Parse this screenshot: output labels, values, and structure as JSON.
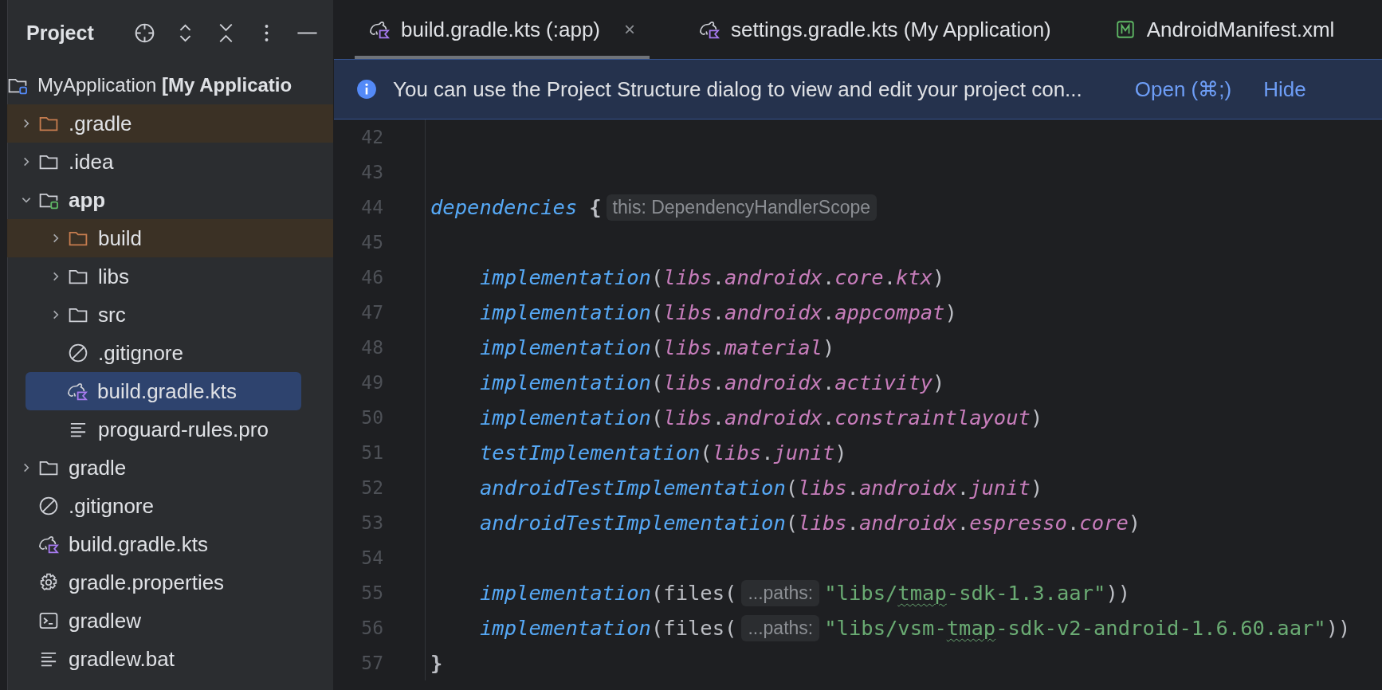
{
  "sidebar": {
    "title": "Project",
    "root": {
      "label": "MyApplication **[My Applicatio**",
      "kind": "project",
      "selected": false
    },
    "tree": [
      {
        "label": ".gradle",
        "kind": "folder",
        "expanded": false,
        "excluded": true,
        "bold": false,
        "selected": false
      },
      {
        "label": ".idea",
        "kind": "folder",
        "expanded": false,
        "excluded": false,
        "bold": false,
        "selected": false
      },
      {
        "label": "app",
        "kind": "module",
        "expanded": true,
        "excluded": false,
        "bold": true,
        "selected": false,
        "children": [
          {
            "label": "build",
            "kind": "folder",
            "expanded": false,
            "excluded": true,
            "bold": false,
            "selected": false
          },
          {
            "label": "libs",
            "kind": "folder",
            "expanded": false,
            "excluded": false,
            "bold": false,
            "selected": false
          },
          {
            "label": "src",
            "kind": "folder",
            "expanded": false,
            "excluded": false,
            "bold": false,
            "selected": false
          },
          {
            "label": ".gitignore",
            "kind": "ignore",
            "excluded": false,
            "bold": false,
            "selected": false
          },
          {
            "label": "build.gradle.kts",
            "kind": "gradle",
            "excluded": false,
            "bold": false,
            "selected": true
          },
          {
            "label": "proguard-rules.pro",
            "kind": "text",
            "excluded": false,
            "bold": false,
            "selected": false
          }
        ]
      },
      {
        "label": "gradle",
        "kind": "folder",
        "expanded": false,
        "excluded": false,
        "bold": false,
        "selected": false
      },
      {
        "label": ".gitignore",
        "kind": "ignore",
        "excluded": false,
        "bold": false,
        "selected": false
      },
      {
        "label": "build.gradle.kts",
        "kind": "gradle",
        "excluded": false,
        "bold": false,
        "selected": false
      },
      {
        "label": "gradle.properties",
        "kind": "gear",
        "excluded": false,
        "bold": false,
        "selected": false
      },
      {
        "label": "gradlew",
        "kind": "terminal",
        "excluded": false,
        "bold": false,
        "selected": false
      },
      {
        "label": "gradlew.bat",
        "kind": "text",
        "excluded": false,
        "bold": false,
        "selected": false
      }
    ]
  },
  "tabs": [
    {
      "label": "build.gradle.kts (:app)",
      "kind": "gradle",
      "selected": true,
      "close": "×"
    },
    {
      "label": "settings.gradle.kts (My Application)",
      "kind": "gradle",
      "selected": false
    },
    {
      "label": "AndroidManifest.xml",
      "kind": "manifest",
      "selected": false
    }
  ],
  "banner": {
    "text": "You can use the Project Structure dialog to view and edit your project con...",
    "links": [
      "Open (⌘;)",
      "Hide"
    ]
  },
  "editor": {
    "lines": [
      {
        "number": "42",
        "kind": "top"
      },
      {
        "number": "43",
        "kind": "top"
      },
      {
        "number": "44",
        "kind": "top",
        "segments": [
          {
            "kind": "code",
            "tokens": [
              {
                "kind": "keyword",
                "text": "dependencies"
              },
              {
                "kind": "brace",
                "text": "{"
              }
            ]
          },
          {
            "kind": "hint",
            "text": "this: DependencyHandlerScope"
          }
        ]
      },
      {
        "number": "45",
        "kind": "top"
      },
      {
        "number": "46",
        "kind": "nested",
        "segments": [
          {
            "kind": "code",
            "tokens": [
              {
                "kind": "keyword",
                "text": "implementation"
              },
              {
                "kind": "punct",
                "text": "("
              },
              {
                "kind": "member",
                "text": "libs"
              },
              {
                "kind": "punct",
                "text": "."
              },
              {
                "kind": "member",
                "text": "androidx"
              },
              {
                "kind": "punct",
                "text": "."
              },
              {
                "kind": "member",
                "text": "core"
              },
              {
                "kind": "punct",
                "text": "."
              },
              {
                "kind": "member",
                "text": "ktx"
              },
              {
                "kind": "punct",
                "text": ")"
              }
            ]
          }
        ]
      },
      {
        "number": "47",
        "kind": "nested",
        "segments": [
          {
            "kind": "code",
            "tokens": [
              {
                "kind": "keyword",
                "text": "implementation"
              },
              {
                "kind": "punct",
                "text": "("
              },
              {
                "kind": "member",
                "text": "libs"
              },
              {
                "kind": "punct",
                "text": "."
              },
              {
                "kind": "member",
                "text": "androidx"
              },
              {
                "kind": "punct",
                "text": "."
              },
              {
                "kind": "member",
                "text": "appcompat"
              },
              {
                "kind": "punct",
                "text": ")"
              }
            ]
          }
        ]
      },
      {
        "number": "48",
        "kind": "nested",
        "segments": [
          {
            "kind": "code",
            "tokens": [
              {
                "kind": "keyword",
                "text": "implementation"
              },
              {
                "kind": "punct",
                "text": "("
              },
              {
                "kind": "member",
                "text": "libs"
              },
              {
                "kind": "punct",
                "text": "."
              },
              {
                "kind": "member",
                "text": "material"
              },
              {
                "kind": "punct",
                "text": ")"
              }
            ]
          }
        ]
      },
      {
        "number": "49",
        "kind": "nested",
        "segments": [
          {
            "kind": "code",
            "tokens": [
              {
                "kind": "keyword",
                "text": "implementation"
              },
              {
                "kind": "punct",
                "text": "("
              },
              {
                "kind": "member",
                "text": "libs"
              },
              {
                "kind": "punct",
                "text": "."
              },
              {
                "kind": "member",
                "text": "androidx"
              },
              {
                "kind": "punct",
                "text": "."
              },
              {
                "kind": "member",
                "text": "activity"
              },
              {
                "kind": "punct",
                "text": ")"
              }
            ]
          }
        ]
      },
      {
        "number": "50",
        "kind": "nested",
        "segments": [
          {
            "kind": "code",
            "tokens": [
              {
                "kind": "keyword",
                "text": "implementation"
              },
              {
                "kind": "punct",
                "text": "("
              },
              {
                "kind": "member",
                "text": "libs"
              },
              {
                "kind": "punct",
                "text": "."
              },
              {
                "kind": "member",
                "text": "androidx"
              },
              {
                "kind": "punct",
                "text": "."
              },
              {
                "kind": "member",
                "text": "constraintlayout"
              },
              {
                "kind": "punct",
                "text": ")"
              }
            ]
          }
        ]
      },
      {
        "number": "51",
        "kind": "nested",
        "segments": [
          {
            "kind": "code",
            "tokens": [
              {
                "kind": "keyword",
                "text": "testImplementation"
              },
              {
                "kind": "punct",
                "text": "("
              },
              {
                "kind": "member",
                "text": "libs"
              },
              {
                "kind": "punct",
                "text": "."
              },
              {
                "kind": "member",
                "text": "junit"
              },
              {
                "kind": "punct",
                "text": ")"
              }
            ]
          }
        ]
      },
      {
        "number": "52",
        "kind": "nested",
        "segments": [
          {
            "kind": "code",
            "tokens": [
              {
                "kind": "keyword",
                "text": "androidTestImplementation"
              },
              {
                "kind": "punct",
                "text": "("
              },
              {
                "kind": "member",
                "text": "libs"
              },
              {
                "kind": "punct",
                "text": "."
              },
              {
                "kind": "member",
                "text": "androidx"
              },
              {
                "kind": "punct",
                "text": "."
              },
              {
                "kind": "member",
                "text": "junit"
              },
              {
                "kind": "punct",
                "text": ")"
              }
            ]
          }
        ]
      },
      {
        "number": "53",
        "kind": "nested",
        "segments": [
          {
            "kind": "code",
            "tokens": [
              {
                "kind": "keyword",
                "text": "androidTestImplementation"
              },
              {
                "kind": "punct",
                "text": "("
              },
              {
                "kind": "member",
                "text": "libs"
              },
              {
                "kind": "punct",
                "text": "."
              },
              {
                "kind": "member",
                "text": "androidx"
              },
              {
                "kind": "punct",
                "text": "."
              },
              {
                "kind": "member",
                "text": "espresso"
              },
              {
                "kind": "punct",
                "text": "."
              },
              {
                "kind": "member",
                "text": "core"
              },
              {
                "kind": "punct",
                "text": ")"
              }
            ]
          }
        ]
      },
      {
        "number": "54",
        "kind": "top"
      },
      {
        "number": "55",
        "kind": "nested",
        "segments": [
          {
            "kind": "code",
            "tokens": [
              {
                "kind": "keyword",
                "text": "implementation"
              },
              {
                "kind": "punct",
                "text": "(files("
              }
            ]
          },
          {
            "kind": "hint",
            "text": "...paths:"
          },
          {
            "kind": "code",
            "tokens": [
              {
                "kind": "string",
                "text": "\"libs/"
              },
              {
                "kind": "typo",
                "text": "tmap"
              },
              {
                "kind": "string",
                "text": "-sdk-1.3.aar\""
              },
              {
                "kind": "punct",
                "text": "))"
              }
            ]
          }
        ]
      },
      {
        "number": "56",
        "kind": "nested",
        "segments": [
          {
            "kind": "code",
            "tokens": [
              {
                "kind": "keyword",
                "text": "implementation"
              },
              {
                "kind": "punct",
                "text": "(files("
              }
            ]
          },
          {
            "kind": "hint",
            "text": "...paths:"
          },
          {
            "kind": "code",
            "tokens": [
              {
                "kind": "string",
                "text": "\"libs/vsm-"
              },
              {
                "kind": "typo",
                "text": "tmap"
              },
              {
                "kind": "string",
                "text": "-sdk-v2-android-1.6.60.aar\""
              },
              {
                "kind": "punct",
                "text": "))"
              }
            ]
          }
        ]
      },
      {
        "number": "57",
        "kind": "top",
        "segments": [
          {
            "kind": "code",
            "tokens": [
              {
                "kind": "brace",
                "text": "}"
              }
            ]
          }
        ]
      }
    ]
  }
}
